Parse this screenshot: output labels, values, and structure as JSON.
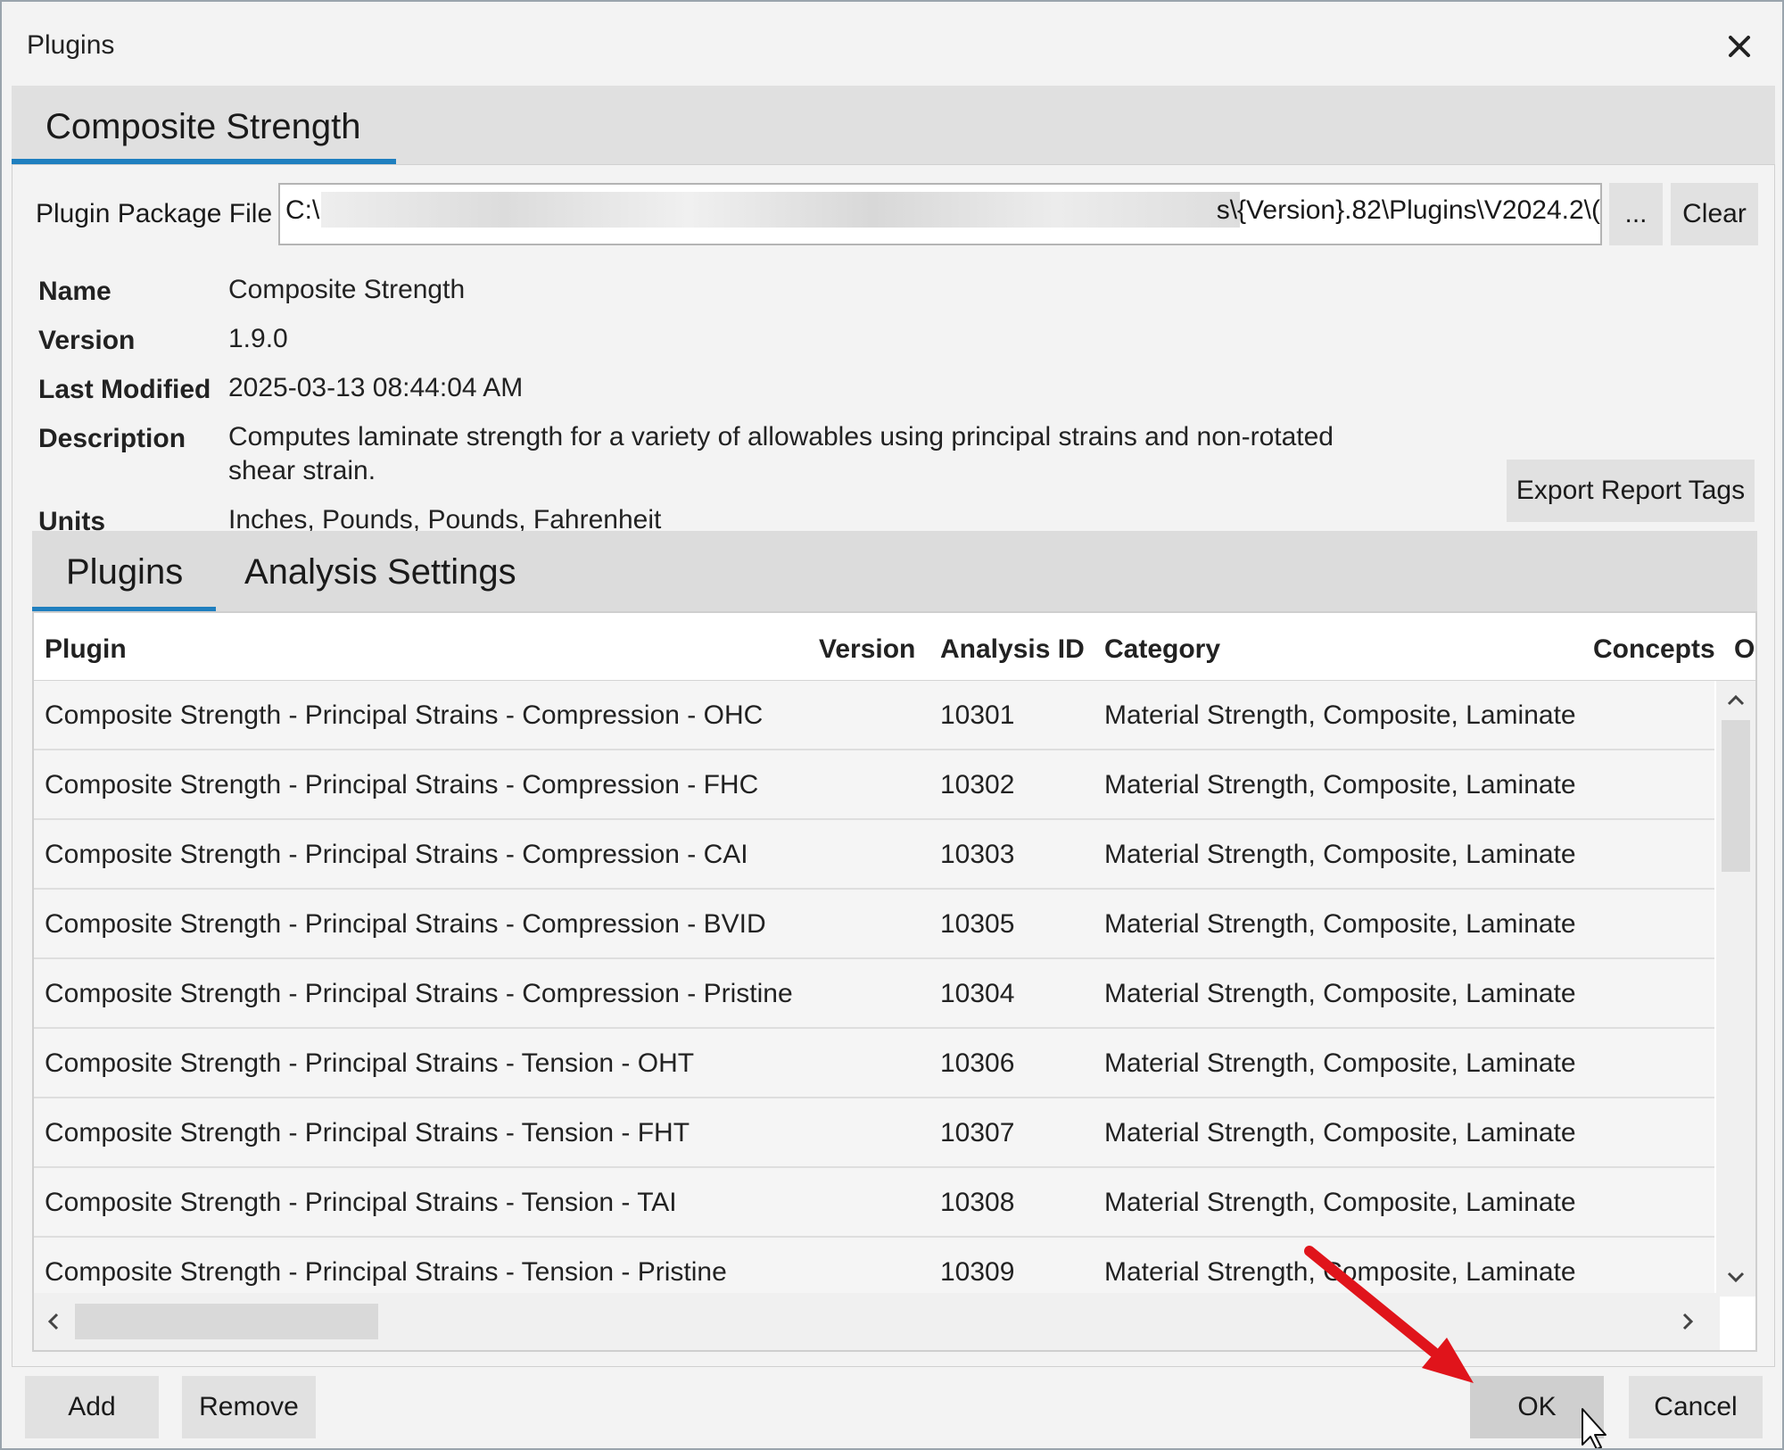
{
  "window": {
    "title": "Plugins"
  },
  "main_tab": {
    "label": "Composite Strength"
  },
  "package": {
    "label": "Plugin Package File",
    "path_start": "C:\\",
    "path_end": "s\\{Version}.82\\Plugins\\V2024.2\\(",
    "browse_label": "...",
    "clear_label": "Clear"
  },
  "properties": [
    {
      "label": "Name",
      "value": "Composite Strength"
    },
    {
      "label": "Version",
      "value": "1.9.0"
    },
    {
      "label": "Last Modified",
      "value": "2025-03-13 08:44:04 AM"
    },
    {
      "label": "Description",
      "value": "Computes laminate strength for a variety of allowables using principal strains and non-rotated shear strain."
    },
    {
      "label": "Units",
      "value": "Inches, Pounds, Pounds, Fahrenheit"
    }
  ],
  "export_button": "Export Report Tags",
  "inner_tabs": [
    {
      "label": "Plugins",
      "active": true
    },
    {
      "label": "Analysis Settings",
      "active": false
    }
  ],
  "table": {
    "columns": [
      "Plugin",
      "Version",
      "Analysis ID",
      "Category",
      "Concepts",
      "Ob"
    ],
    "rows": [
      {
        "plugin": "Composite Strength - Principal Strains - Compression - OHC",
        "version": "",
        "analysis_id": "10301",
        "category": "Material Strength, Composite, Laminate",
        "concepts": ""
      },
      {
        "plugin": "Composite Strength - Principal Strains - Compression - FHC",
        "version": "",
        "analysis_id": "10302",
        "category": "Material Strength, Composite, Laminate",
        "concepts": ""
      },
      {
        "plugin": "Composite Strength - Principal Strains - Compression - CAI",
        "version": "",
        "analysis_id": "10303",
        "category": "Material Strength, Composite, Laminate",
        "concepts": ""
      },
      {
        "plugin": "Composite Strength - Principal Strains - Compression - BVID",
        "version": "",
        "analysis_id": "10305",
        "category": "Material Strength, Composite, Laminate",
        "concepts": ""
      },
      {
        "plugin": "Composite Strength - Principal Strains - Compression - Pristine",
        "version": "",
        "analysis_id": "10304",
        "category": "Material Strength, Composite, Laminate",
        "concepts": ""
      },
      {
        "plugin": "Composite Strength - Principal Strains - Tension - OHT",
        "version": "",
        "analysis_id": "10306",
        "category": "Material Strength, Composite, Laminate",
        "concepts": ""
      },
      {
        "plugin": "Composite Strength - Principal Strains - Tension - FHT",
        "version": "",
        "analysis_id": "10307",
        "category": "Material Strength, Composite, Laminate",
        "concepts": ""
      },
      {
        "plugin": "Composite Strength - Principal Strains - Tension - TAI",
        "version": "",
        "analysis_id": "10308",
        "category": "Material Strength, Composite, Laminate",
        "concepts": ""
      },
      {
        "plugin": "Composite Strength - Principal Strains - Tension - Pristine",
        "version": "",
        "analysis_id": "10309",
        "category": "Material Strength, Composite, Laminate",
        "concepts": ""
      }
    ]
  },
  "footer": {
    "add_label": "Add",
    "remove_label": "Remove",
    "ok_label": "OK",
    "cancel_label": "Cancel"
  },
  "icons": {
    "close": "close-icon",
    "scroll_up": "chevron-up-icon",
    "scroll_down": "chevron-down-icon",
    "scroll_left": "chevron-left-icon",
    "scroll_right": "chevron-right-icon",
    "pointer": "mouse-pointer-icon",
    "annotation_arrow": "red-arrow-icon"
  },
  "colors": {
    "accent": "#1f7fbf",
    "annotation_arrow": "#e0141b",
    "window_bg": "#f3f3f3"
  }
}
